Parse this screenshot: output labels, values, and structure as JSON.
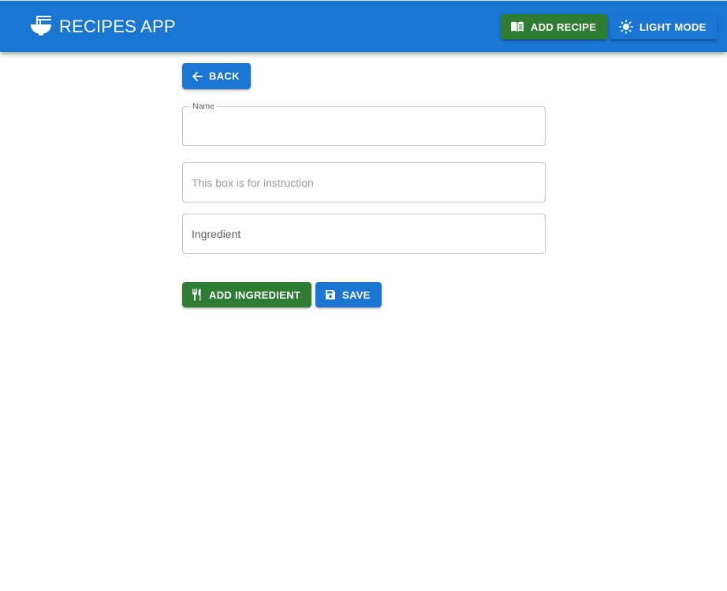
{
  "header": {
    "title": "RECIPES APP",
    "logo_icon": "noodle-bowl-icon",
    "add_recipe_label": "ADD RECIPE",
    "add_recipe_icon": "menu-book-icon",
    "light_mode_label": "LIGHT MODE",
    "light_mode_icon": "sun-icon"
  },
  "form": {
    "back_label": "BACK",
    "back_icon": "arrow-left-icon",
    "name_label": "Name",
    "name_value": "",
    "instruction_placeholder": "This box is for instruction",
    "ingredient_placeholder": "Ingredient",
    "add_ingredient_label": "ADD INGREDIENT",
    "add_ingredient_icon": "fork-knife-icon",
    "save_label": "SAVE",
    "save_icon": "floppy-disk-icon"
  },
  "colors": {
    "primary": "#1976d2",
    "success": "#2e7d32",
    "outline": "#c4c4c4"
  }
}
